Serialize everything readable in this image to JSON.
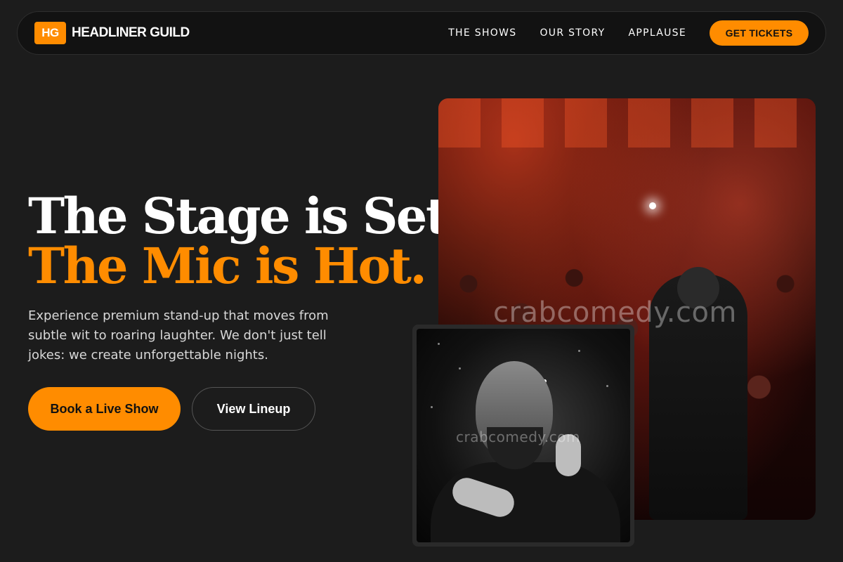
{
  "brand": {
    "mark": "HG",
    "name": "HEADLINER GUILD",
    "accent_color": "#ff8c00"
  },
  "nav": {
    "links": [
      "THE SHOWS",
      "OUR STORY",
      "APPLAUSE"
    ],
    "cta": "GET TICKETS"
  },
  "hero": {
    "title_line1": "The Stage is Set.",
    "title_line2": "The Mic is Hot.",
    "subtitle": "Experience premium stand-up that moves from subtle wit to roaring laughter. We don't just tell jokes: we create unforgettable nights.",
    "primary_button": "Book a Live Show",
    "secondary_button": "View Lineup"
  },
  "images": {
    "crowd_watermark": "crabcomedy.com",
    "comic_watermark": "crabcomedy.com"
  }
}
